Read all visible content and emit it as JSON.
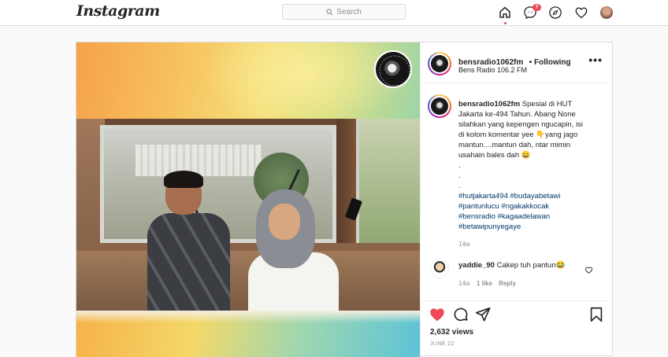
{
  "app": {
    "logo": "Instagram"
  },
  "search": {
    "placeholder": "Search"
  },
  "nav": {
    "notification_count": "7"
  },
  "post": {
    "username": "bensradio1062fm",
    "following_label": "• Following",
    "location": "Bens Radio 106.2 FM",
    "more_label": "•••",
    "caption_user": "bensradio1062fm",
    "caption_lines": [
      "Spesial di HUT",
      "Jakarta ke-494 Tahun. Abang None",
      "silahkan yang kepengen ngucapin, isi",
      "di kolom komentar yee 👇yang jago",
      "mantun....mantun dah, ntar mimin",
      "usahain bales dah 😄",
      ".",
      ".",
      "."
    ],
    "hashtags": [
      "#hutjakarta494 #budayabetawi",
      "#pantunlucu #ngakakkocak",
      "#bensradio #kagaadelawan",
      "#betawipunyegaye"
    ],
    "time_ago": "14w",
    "comment": {
      "username": "yaddie_90",
      "text": "Cakep tuh pantun😂",
      "time": "14w",
      "likes": "1 like",
      "reply": "Reply"
    },
    "views": "2,632 views",
    "date": "JUNE 22"
  },
  "colors": {
    "like_red": "#ed4956",
    "link_blue": "#00376b",
    "muted": "#8e8e8e"
  },
  "icons": [
    "search-icon",
    "home-icon",
    "messenger-icon",
    "explore-icon",
    "heart-icon",
    "heart-filled-icon",
    "comment-icon",
    "share-icon",
    "bookmark-icon",
    "more-icon"
  ]
}
